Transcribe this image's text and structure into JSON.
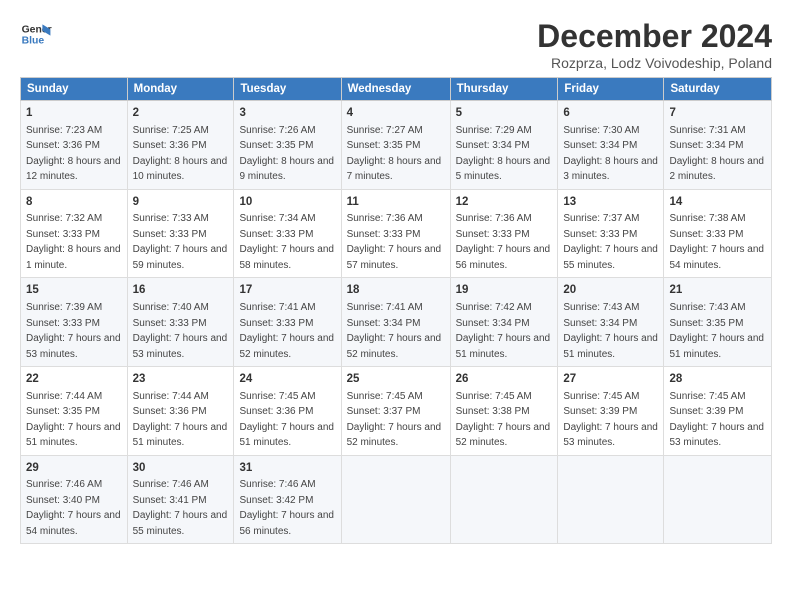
{
  "header": {
    "logo_line1": "General",
    "logo_line2": "Blue",
    "title": "December 2024",
    "subtitle": "Rozprza, Lodz Voivodeship, Poland"
  },
  "columns": [
    "Sunday",
    "Monday",
    "Tuesday",
    "Wednesday",
    "Thursday",
    "Friday",
    "Saturday"
  ],
  "weeks": [
    [
      {
        "day": "1",
        "sunrise": "Sunrise: 7:23 AM",
        "sunset": "Sunset: 3:36 PM",
        "daylight": "Daylight: 8 hours and 12 minutes."
      },
      {
        "day": "2",
        "sunrise": "Sunrise: 7:25 AM",
        "sunset": "Sunset: 3:36 PM",
        "daylight": "Daylight: 8 hours and 10 minutes."
      },
      {
        "day": "3",
        "sunrise": "Sunrise: 7:26 AM",
        "sunset": "Sunset: 3:35 PM",
        "daylight": "Daylight: 8 hours and 9 minutes."
      },
      {
        "day": "4",
        "sunrise": "Sunrise: 7:27 AM",
        "sunset": "Sunset: 3:35 PM",
        "daylight": "Daylight: 8 hours and 7 minutes."
      },
      {
        "day": "5",
        "sunrise": "Sunrise: 7:29 AM",
        "sunset": "Sunset: 3:34 PM",
        "daylight": "Daylight: 8 hours and 5 minutes."
      },
      {
        "day": "6",
        "sunrise": "Sunrise: 7:30 AM",
        "sunset": "Sunset: 3:34 PM",
        "daylight": "Daylight: 8 hours and 3 minutes."
      },
      {
        "day": "7",
        "sunrise": "Sunrise: 7:31 AM",
        "sunset": "Sunset: 3:34 PM",
        "daylight": "Daylight: 8 hours and 2 minutes."
      }
    ],
    [
      {
        "day": "8",
        "sunrise": "Sunrise: 7:32 AM",
        "sunset": "Sunset: 3:33 PM",
        "daylight": "Daylight: 8 hours and 1 minute."
      },
      {
        "day": "9",
        "sunrise": "Sunrise: 7:33 AM",
        "sunset": "Sunset: 3:33 PM",
        "daylight": "Daylight: 7 hours and 59 minutes."
      },
      {
        "day": "10",
        "sunrise": "Sunrise: 7:34 AM",
        "sunset": "Sunset: 3:33 PM",
        "daylight": "Daylight: 7 hours and 58 minutes."
      },
      {
        "day": "11",
        "sunrise": "Sunrise: 7:36 AM",
        "sunset": "Sunset: 3:33 PM",
        "daylight": "Daylight: 7 hours and 57 minutes."
      },
      {
        "day": "12",
        "sunrise": "Sunrise: 7:36 AM",
        "sunset": "Sunset: 3:33 PM",
        "daylight": "Daylight: 7 hours and 56 minutes."
      },
      {
        "day": "13",
        "sunrise": "Sunrise: 7:37 AM",
        "sunset": "Sunset: 3:33 PM",
        "daylight": "Daylight: 7 hours and 55 minutes."
      },
      {
        "day": "14",
        "sunrise": "Sunrise: 7:38 AM",
        "sunset": "Sunset: 3:33 PM",
        "daylight": "Daylight: 7 hours and 54 minutes."
      }
    ],
    [
      {
        "day": "15",
        "sunrise": "Sunrise: 7:39 AM",
        "sunset": "Sunset: 3:33 PM",
        "daylight": "Daylight: 7 hours and 53 minutes."
      },
      {
        "day": "16",
        "sunrise": "Sunrise: 7:40 AM",
        "sunset": "Sunset: 3:33 PM",
        "daylight": "Daylight: 7 hours and 53 minutes."
      },
      {
        "day": "17",
        "sunrise": "Sunrise: 7:41 AM",
        "sunset": "Sunset: 3:33 PM",
        "daylight": "Daylight: 7 hours and 52 minutes."
      },
      {
        "day": "18",
        "sunrise": "Sunrise: 7:41 AM",
        "sunset": "Sunset: 3:34 PM",
        "daylight": "Daylight: 7 hours and 52 minutes."
      },
      {
        "day": "19",
        "sunrise": "Sunrise: 7:42 AM",
        "sunset": "Sunset: 3:34 PM",
        "daylight": "Daylight: 7 hours and 51 minutes."
      },
      {
        "day": "20",
        "sunrise": "Sunrise: 7:43 AM",
        "sunset": "Sunset: 3:34 PM",
        "daylight": "Daylight: 7 hours and 51 minutes."
      },
      {
        "day": "21",
        "sunrise": "Sunrise: 7:43 AM",
        "sunset": "Sunset: 3:35 PM",
        "daylight": "Daylight: 7 hours and 51 minutes."
      }
    ],
    [
      {
        "day": "22",
        "sunrise": "Sunrise: 7:44 AM",
        "sunset": "Sunset: 3:35 PM",
        "daylight": "Daylight: 7 hours and 51 minutes."
      },
      {
        "day": "23",
        "sunrise": "Sunrise: 7:44 AM",
        "sunset": "Sunset: 3:36 PM",
        "daylight": "Daylight: 7 hours and 51 minutes."
      },
      {
        "day": "24",
        "sunrise": "Sunrise: 7:45 AM",
        "sunset": "Sunset: 3:36 PM",
        "daylight": "Daylight: 7 hours and 51 minutes."
      },
      {
        "day": "25",
        "sunrise": "Sunrise: 7:45 AM",
        "sunset": "Sunset: 3:37 PM",
        "daylight": "Daylight: 7 hours and 52 minutes."
      },
      {
        "day": "26",
        "sunrise": "Sunrise: 7:45 AM",
        "sunset": "Sunset: 3:38 PM",
        "daylight": "Daylight: 7 hours and 52 minutes."
      },
      {
        "day": "27",
        "sunrise": "Sunrise: 7:45 AM",
        "sunset": "Sunset: 3:39 PM",
        "daylight": "Daylight: 7 hours and 53 minutes."
      },
      {
        "day": "28",
        "sunrise": "Sunrise: 7:45 AM",
        "sunset": "Sunset: 3:39 PM",
        "daylight": "Daylight: 7 hours and 53 minutes."
      }
    ],
    [
      {
        "day": "29",
        "sunrise": "Sunrise: 7:46 AM",
        "sunset": "Sunset: 3:40 PM",
        "daylight": "Daylight: 7 hours and 54 minutes."
      },
      {
        "day": "30",
        "sunrise": "Sunrise: 7:46 AM",
        "sunset": "Sunset: 3:41 PM",
        "daylight": "Daylight: 7 hours and 55 minutes."
      },
      {
        "day": "31",
        "sunrise": "Sunrise: 7:46 AM",
        "sunset": "Sunset: 3:42 PM",
        "daylight": "Daylight: 7 hours and 56 minutes."
      },
      null,
      null,
      null,
      null
    ]
  ]
}
